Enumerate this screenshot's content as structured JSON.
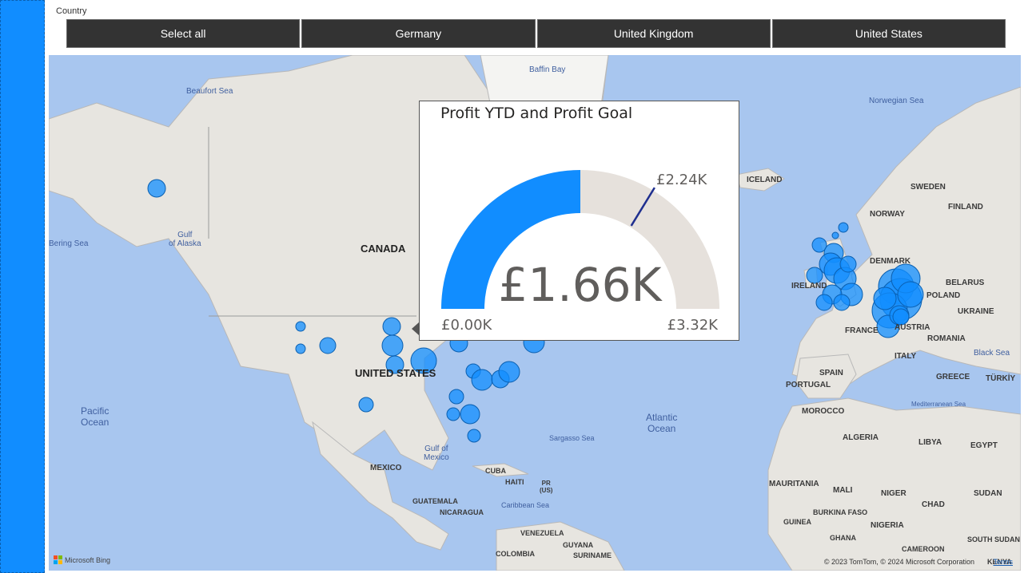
{
  "slicer": {
    "title": "Country",
    "options": [
      "Select all",
      "Germany",
      "United Kingdom",
      "United States"
    ]
  },
  "map": {
    "labels": {
      "baffin_bay": "Baffin Bay",
      "beaufort_sea": "Beaufort Sea",
      "norwegian_sea": "Norwegian Sea",
      "iceland": "ICELAND",
      "sweden": "SWEDEN",
      "finland": "FINLAND",
      "norway": "NORWAY",
      "gulf_of_alaska": "Gulf\nof Alaska",
      "bering_sea": "Bering Sea",
      "canada": "CANADA",
      "denmark": "DENMARK",
      "ireland": "IRELAND",
      "belarus": "BELARUS",
      "poland": "POLAND",
      "ukraine": "UKRAINE",
      "france": "FRANCE",
      "austria": "AUSTRIA",
      "romania": "ROMANIA",
      "black_sea": "Black Sea",
      "italy": "ITALY",
      "united_states": "UNITED STATES",
      "spain": "SPAIN",
      "portugal": "PORTUGAL",
      "greece": "GREECE",
      "turkiye": "TÜRKİY",
      "pacific_ocean": "Pacific\nOcean",
      "atlantic_ocean": "Atlantic\nOcean",
      "morocco": "MOROCCO",
      "mediterranean_sea": "Mediterranean Sea",
      "algeria": "ALGERIA",
      "libya": "LIBYA",
      "egypt": "EGYPT",
      "gulf_of_mexico": "Gulf of\nMexico",
      "sargasso_sea": "Sargasso Sea",
      "mexico": "MEXICO",
      "cuba": "CUBA",
      "haiti": "HAITI",
      "pr": "PR\n(US)",
      "guatemala": "GUATEMALA",
      "nicaragua": "NICARAGUA",
      "caribbean_sea": "Caribbean Sea",
      "mauritania": "MAURITANIA",
      "mali": "MALI",
      "niger": "NIGER",
      "chad": "CHAD",
      "sudan": "SUDAN",
      "burkina_faso": "BURKINA FASO",
      "guinea": "GUINEA",
      "nigeria": "NIGERIA",
      "ghana": "GHANA",
      "cameroon": "CAMEROON",
      "south_sudan": "SOUTH SUDAN",
      "venezuela": "VENEZUELA",
      "guyana": "GUYANA",
      "suriname": "SURINAME",
      "colombia": "COLOMBIA",
      "kenya": "KENYA"
    },
    "attribution": {
      "bing": "Microsoft Bing",
      "copyright": "© 2023 TomTom, © 2024 Microsoft Corporation",
      "terms": "Terms"
    },
    "bubble_color": "#118dff"
  },
  "tooltip": {
    "title": "Profit YTD and Profit Goal",
    "value_label": "£1.66K",
    "min_label": "£0.00K",
    "max_label": "£3.32K",
    "target_label": "£2.24K"
  },
  "chart_data": {
    "type": "gauge",
    "title": "Profit YTD and Profit Goal",
    "value": 1.66,
    "min": 0,
    "max": 3.32,
    "target": 2.24,
    "units": "£K",
    "fill_color": "#118dff",
    "track_color": "#e6e1dc",
    "target_color": "#1f2f8f"
  }
}
